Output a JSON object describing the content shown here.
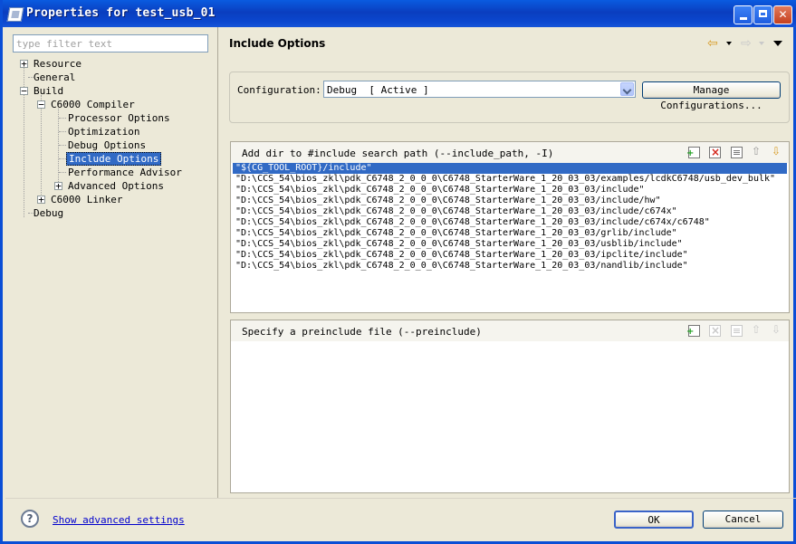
{
  "window": {
    "title": "Properties for test_usb_01"
  },
  "filter": {
    "placeholder": "type filter text"
  },
  "tree": {
    "items": [
      {
        "label": "Resource",
        "expander": "+"
      },
      {
        "label": "General"
      },
      {
        "label": "Build",
        "expander": "−"
      },
      {
        "label": "C6000 Compiler",
        "expander": "−"
      },
      {
        "label": "Processor Options"
      },
      {
        "label": "Optimization"
      },
      {
        "label": "Debug Options"
      },
      {
        "label": "Include Options",
        "selected": true
      },
      {
        "label": "Performance Advisor"
      },
      {
        "label": "Advanced Options",
        "expander": "+"
      },
      {
        "label": "C6000 Linker",
        "expander": "+"
      },
      {
        "label": "Debug"
      }
    ]
  },
  "page": {
    "heading": "Include Options"
  },
  "config": {
    "label": "Configuration:",
    "value": "Debug  [ Active ]",
    "manage_label": "Manage Configurations..."
  },
  "include_panel": {
    "title": "Add dir to #include search path (--include_path, -I)",
    "paths": [
      "\"${CG_TOOL_ROOT}/include\"",
      "\"D:\\CCS_54\\bios_zkl\\pdk_C6748_2_0_0_0\\C6748_StarterWare_1_20_03_03/examples/lcdkC6748/usb_dev_bulk\"",
      "\"D:\\CCS_54\\bios_zkl\\pdk_C6748_2_0_0_0\\C6748_StarterWare_1_20_03_03/include\"",
      "\"D:\\CCS_54\\bios_zkl\\pdk_C6748_2_0_0_0\\C6748_StarterWare_1_20_03_03/include/hw\"",
      "\"D:\\CCS_54\\bios_zkl\\pdk_C6748_2_0_0_0\\C6748_StarterWare_1_20_03_03/include/c674x\"",
      "\"D:\\CCS_54\\bios_zkl\\pdk_C6748_2_0_0_0\\C6748_StarterWare_1_20_03_03/include/c674x/c6748\"",
      "\"D:\\CCS_54\\bios_zkl\\pdk_C6748_2_0_0_0\\C6748_StarterWare_1_20_03_03/grlib/include\"",
      "\"D:\\CCS_54\\bios_zkl\\pdk_C6748_2_0_0_0\\C6748_StarterWare_1_20_03_03/usblib/include\"",
      "\"D:\\CCS_54\\bios_zkl\\pdk_C6748_2_0_0_0\\C6748_StarterWare_1_20_03_03/ipclite/include\"",
      "\"D:\\CCS_54\\bios_zkl\\pdk_C6748_2_0_0_0\\C6748_StarterWare_1_20_03_03/nandlib/include\""
    ],
    "selected_index": 0
  },
  "preinclude_panel": {
    "title": "Specify a preinclude file (--preinclude)"
  },
  "footer": {
    "help_glyph": "?",
    "advanced_link": "Show advanced settings",
    "ok_label": "OK",
    "cancel_label": "Cancel"
  },
  "colors": {
    "titlebar": "#0a4ed6",
    "dialog_bg": "#ece9d8",
    "selection": "#316ac5",
    "link": "#0000cc"
  }
}
